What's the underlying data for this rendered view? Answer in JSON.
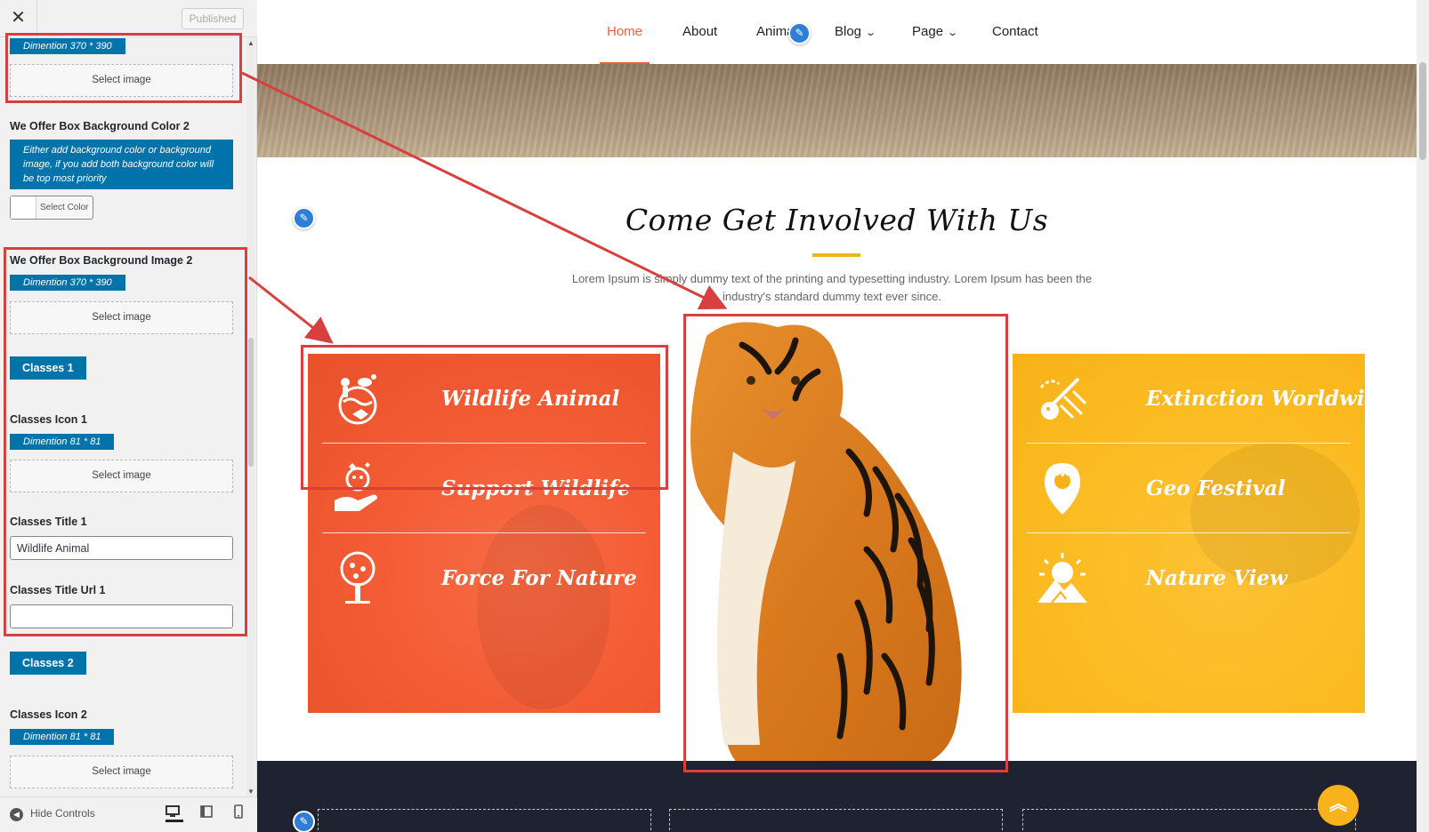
{
  "customizer": {
    "close_glyph": "✕",
    "published_label": "Published",
    "top_dimension_note": "Dimention 370 * 390",
    "top_select_image": "Select image",
    "bg_color_2_label": "We Offer Box Background Color 2",
    "bg_color_2_desc": "Either add background color or background image, if you add both background color will be top most priority",
    "select_color_label": "Select Color",
    "bg_image_2_label": "We Offer Box Background Image 2",
    "bg_image_2_note": "Dimention 370 * 390",
    "bg_image_2_select": "Select image",
    "classes_1_button": "Classes 1",
    "classes_icon_1_label": "Classes Icon 1",
    "classes_icon_1_note": "Dimention 81 * 81",
    "classes_icon_1_select": "Select image",
    "classes_title_1_label": "Classes Title 1",
    "classes_title_1_value": "Wildlife Animal",
    "classes_title_url_1_label": "Classes Title Url 1",
    "classes_title_url_1_value": "",
    "classes_2_button": "Classes 2",
    "classes_icon_2_label": "Classes Icon 2",
    "classes_icon_2_note": "Dimention 81 * 81",
    "classes_icon_2_select": "Select image",
    "hide_controls_label": "Hide Controls"
  },
  "site": {
    "nav": [
      {
        "label": "Home",
        "active": true
      },
      {
        "label": "About"
      },
      {
        "label": "Anima"
      },
      {
        "label": "Blog",
        "dropdown": true
      },
      {
        "label": "Page",
        "dropdown": true
      },
      {
        "label": "Contact"
      }
    ],
    "section_title": "Come Get Involved With Us",
    "section_desc": "Lorem Ipsum is simply dummy text of the printing and typesetting industry. Lorem Ipsum has been the industry's standard dummy text ever since.",
    "left_box_items": [
      "Wildlife Animal",
      "Support Wildlife",
      "Force For Nature"
    ],
    "right_box_items": [
      "Extinction Worldwide",
      "Geo Festival",
      "Nature View"
    ],
    "colors": {
      "accent_red": "#f25a33",
      "accent_yellow": "#fbba21",
      "customizer_blue": "#0073aa",
      "highlight_red": "#d8403f"
    },
    "icons": {
      "left": [
        "wildlife-globe-icon",
        "support-hand-icon",
        "nature-tree-icon"
      ],
      "right": [
        "extinction-dinosaur-icon",
        "location-pin-icon",
        "sun-mountain-icon"
      ],
      "scroll_top": "double-chevron-up-icon"
    }
  }
}
